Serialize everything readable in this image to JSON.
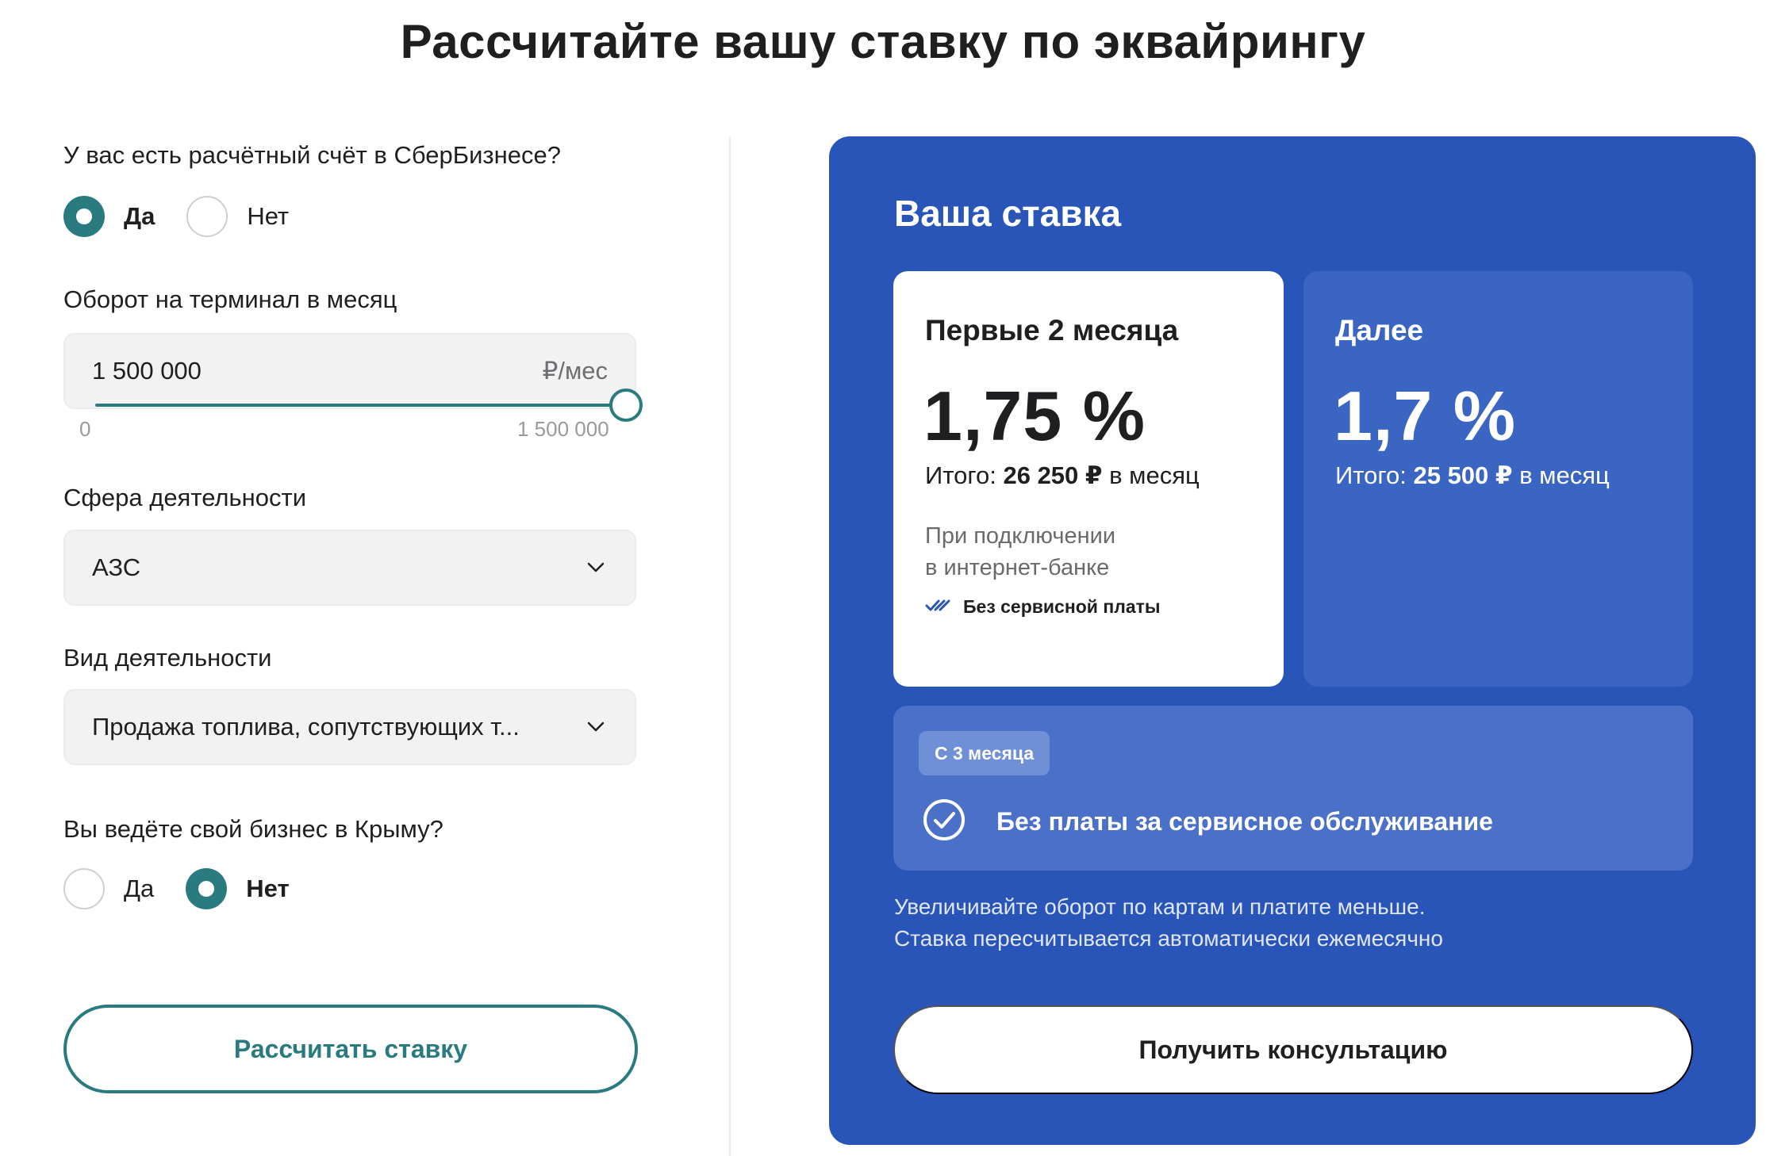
{
  "page": {
    "title": "Рассчитайте вашу ставку по эквайрингу"
  },
  "form": {
    "account_question": {
      "label": "У вас есть расчётный счёт в СберБизнесе?",
      "options": [
        {
          "label": "Да",
          "selected": true
        },
        {
          "label": "Нет",
          "selected": false
        }
      ]
    },
    "turnover": {
      "label": "Оборот на терминал в месяц",
      "value": "1 500 000",
      "suffix": "₽/мес",
      "slider": {
        "min_label": "0",
        "max_label": "1 500 000",
        "fraction": 1.0
      }
    },
    "sphere": {
      "label": "Сфера деятельности",
      "value": "АЗС"
    },
    "activity": {
      "label": "Вид деятельности",
      "value": "Продажа топлива, сопутствующих т..."
    },
    "crimea_question": {
      "label": "Вы ведёте свой бизнес в Крыму?",
      "options": [
        {
          "label": "Да",
          "selected": false
        },
        {
          "label": "Нет",
          "selected": true
        }
      ]
    },
    "calculate_button": "Рассчитать ставку"
  },
  "rate_panel": {
    "title": "Ваша ставка",
    "first_card": {
      "heading": "Первые 2 месяца",
      "rate": "1,75 %",
      "total_prefix": "Итого: ",
      "total_amount": "26 250 ₽",
      "total_suffix": " в месяц",
      "note_line1": "При подключении",
      "note_line2": "в интернет-банке",
      "no_fee": "Без сервисной платы"
    },
    "next_card": {
      "heading": "Далее",
      "rate": "1,7 %",
      "total_prefix": "Итого: ",
      "total_amount": "25 500 ₽",
      "total_suffix": " в месяц"
    },
    "from3": {
      "badge": "С 3 месяца",
      "text": "Без платы за сервисное обслуживание"
    },
    "info_line1": "Увеличивайте оборот по картам и платите меньше.",
    "info_line2": "Ставка пересчитывается автоматически ежемесячно",
    "consult_button": "Получить консультацию"
  },
  "colors": {
    "accent": "#2a7b80",
    "panel_bg": "#2a55b8",
    "card_next_bg": "#3b65c2",
    "from3_bg": "#4a70c8"
  },
  "icons": [
    "chevron-down-icon",
    "double-check-icon",
    "check-circle-icon"
  ]
}
